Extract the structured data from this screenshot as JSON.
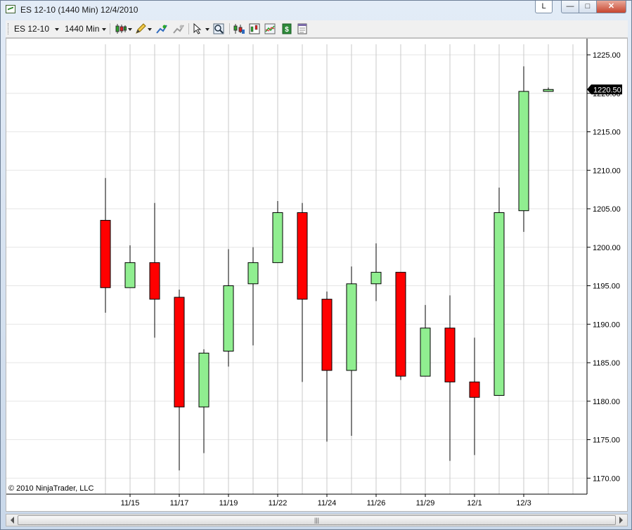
{
  "window": {
    "title": "ES 12-10 (1440 Min)  12/4/2010",
    "btn_l": "L",
    "btn_min": "—",
    "btn_max": "□",
    "btn_close": "✕"
  },
  "toolbar": {
    "instrument": "ES 12-10",
    "interval": "1440 Min",
    "icons": [
      "candlestick-style-icon",
      "pencil-draw-icon",
      "add-indicator-icon",
      "remove-indicator-icon",
      "cursor-pointer-icon",
      "zoom-icon",
      "strategies-icon",
      "chart-trader-icon",
      "data-box-icon",
      "dollar-icon",
      "properties-icon"
    ]
  },
  "chart": {
    "copyright": "© 2010 NinjaTrader, LLC",
    "price_marker": "1220.50"
  },
  "scrollbar": {
    "grip": "|||"
  },
  "chart_data": {
    "type": "candlestick",
    "yaxis": {
      "min": 1170,
      "max": 1225,
      "step": 5,
      "decimals": 2
    },
    "up_color": "#90ee90",
    "down_color": "#ff0000",
    "last_price": 1220.5,
    "date_labels": [
      "11/15",
      "11/17",
      "11/19",
      "11/22",
      "11/24",
      "11/26",
      "11/29",
      "12/1",
      "12/3"
    ],
    "bars": [
      {
        "o": 1203.5,
        "h": 1209.0,
        "l": 1191.5,
        "c": 1194.75
      },
      {
        "o": 1194.75,
        "h": 1200.25,
        "l": 1194.75,
        "c": 1198.0
      },
      {
        "o": 1198.0,
        "h": 1205.75,
        "l": 1188.25,
        "c": 1193.25
      },
      {
        "o": 1193.5,
        "h": 1194.5,
        "l": 1171.0,
        "c": 1179.25
      },
      {
        "o": 1179.25,
        "h": 1186.75,
        "l": 1173.25,
        "c": 1186.25
      },
      {
        "o": 1186.5,
        "h": 1199.75,
        "l": 1184.5,
        "c": 1195.0
      },
      {
        "o": 1195.25,
        "h": 1200.0,
        "l": 1187.25,
        "c": 1198.0
      },
      {
        "o": 1198.0,
        "h": 1206.0,
        "l": 1198.0,
        "c": 1204.5
      },
      {
        "o": 1204.5,
        "h": 1205.75,
        "l": 1182.5,
        "c": 1193.25
      },
      {
        "o": 1193.25,
        "h": 1194.25,
        "l": 1174.75,
        "c": 1184.0
      },
      {
        "o": 1184.0,
        "h": 1197.5,
        "l": 1175.5,
        "c": 1195.25
      },
      {
        "o": 1195.25,
        "h": 1200.5,
        "l": 1193.0,
        "c": 1196.75
      },
      {
        "o": 1196.75,
        "h": 1196.75,
        "l": 1182.75,
        "c": 1183.25
      },
      {
        "o": 1183.25,
        "h": 1192.5,
        "l": 1183.25,
        "c": 1189.5
      },
      {
        "o": 1189.5,
        "h": 1193.75,
        "l": 1172.25,
        "c": 1182.5
      },
      {
        "o": 1182.5,
        "h": 1188.25,
        "l": 1173.0,
        "c": 1180.5
      },
      {
        "o": 1180.75,
        "h": 1207.75,
        "l": 1180.75,
        "c": 1204.5
      },
      {
        "o": 1204.75,
        "h": 1223.5,
        "l": 1202.0,
        "c": 1220.25
      },
      {
        "o": 1220.25,
        "h": 1220.75,
        "l": 1220.25,
        "c": 1220.5
      }
    ]
  }
}
